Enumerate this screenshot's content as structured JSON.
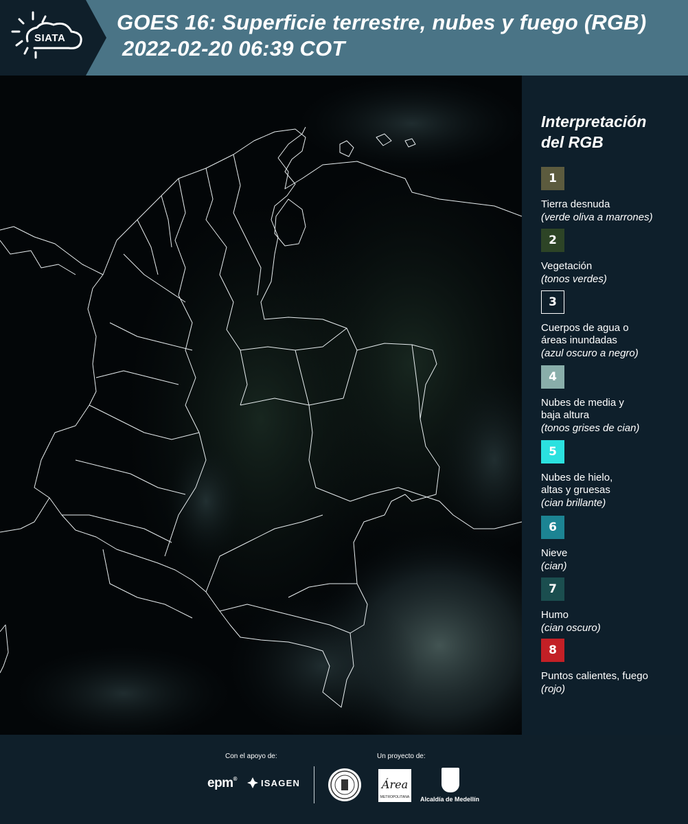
{
  "header": {
    "logo_text": "SIATA",
    "title_line1": "GOES 16: Superficie terrestre, nubes y fuego (RGB)",
    "title_line2": "2022-02-20 06:39 COT"
  },
  "legend": {
    "title_line1": "Interpretación",
    "title_line2": "del RGB",
    "items": [
      {
        "number": "1",
        "color": "#5c5b3e",
        "label": "Tierra desnuda",
        "desc": "(verde oliva a marrones)"
      },
      {
        "number": "2",
        "color": "#2d4426",
        "label": "Vegetación",
        "desc": "(tonos verdes)"
      },
      {
        "number": "3",
        "color": "#0e1f2b",
        "label": "Cuerpos de agua o\náreas inundadas",
        "desc": "(azul oscuro a negro)"
      },
      {
        "number": "4",
        "color": "#89aeaa",
        "label": "Nubes de media y\nbaja altura",
        "desc": "(tonos grises de cian)"
      },
      {
        "number": "5",
        "color": "#2be1df",
        "label": "Nubes de hielo,\naltas y gruesas",
        "desc": "(cian brillante)"
      },
      {
        "number": "6",
        "color": "#1c8493",
        "label": "Nieve",
        "desc": "(cian)"
      },
      {
        "number": "7",
        "color": "#1b4e4f",
        "label": "Humo",
        "desc": "(cian oscuro)"
      },
      {
        "number": "8",
        "color": "#c32026",
        "label": "Puntos calientes, fuego",
        "desc": "(rojo)"
      }
    ]
  },
  "footer": {
    "support_label": "Con el apoyo de:",
    "project_label": "Un proyecto de:",
    "epm": "epm",
    "epm_mark": "®",
    "isagen": "ISAGEN",
    "metro_script": "Área",
    "metro_caption": "METROPOLITANA",
    "alcaldia": "Alcaldía de Medellín"
  }
}
